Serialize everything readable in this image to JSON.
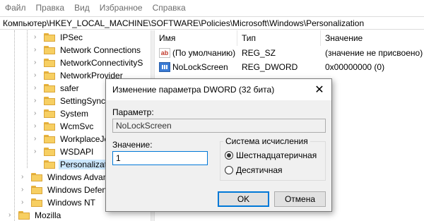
{
  "menu": [
    "Файл",
    "Правка",
    "Вид",
    "Избранное",
    "Справка"
  ],
  "address": "Компьютер\\HKEY_LOCAL_MACHINE\\SOFTWARE\\Policies\\Microsoft\\Windows\\Personalization",
  "tree": [
    {
      "label": "IPSec",
      "expander": true
    },
    {
      "label": "Network Connections",
      "expander": true
    },
    {
      "label": "NetworkConnectivityS",
      "expander": true
    },
    {
      "label": "NetworkProvider",
      "expander": true
    },
    {
      "label": "safer",
      "expander": true
    },
    {
      "label": "SettingSync",
      "expander": true
    },
    {
      "label": "System",
      "expander": true
    },
    {
      "label": "WcmSvc",
      "expander": true
    },
    {
      "label": "WorkplaceJo",
      "expander": true
    },
    {
      "label": "WSDAPI",
      "expander": true
    },
    {
      "label": "Personalization",
      "expander": false,
      "selected": true
    },
    {
      "label": "Windows Advan",
      "expander": true
    },
    {
      "label": "Windows Defen",
      "expander": true
    },
    {
      "label": "Windows NT",
      "expander": true
    },
    {
      "label": "Mozilla",
      "expander": true
    }
  ],
  "list": {
    "headers": [
      "Имя",
      "Тип",
      "Значение"
    ],
    "rows": [
      {
        "icon": "string-value-icon",
        "badge": "ab",
        "name": "(По умолчанию)",
        "type": "REG_SZ",
        "value": "(значение не присвоено)"
      },
      {
        "icon": "binary-value-icon",
        "badge": "",
        "name": "NoLockScreen",
        "type": "REG_DWORD",
        "value": "0x00000000 (0)"
      }
    ]
  },
  "dialog": {
    "title": "Изменение параметра DWORD (32 бита)",
    "close_glyph": "✕",
    "param_label": "Параметр:",
    "param_value": "NoLockScreen",
    "value_label": "Значение:",
    "value": "1",
    "base_label": "Система исчисления",
    "radio_hex": "Шестнадцатеричная",
    "radio_dec": "Десятичная",
    "selected_base": "hex",
    "ok": "OK",
    "cancel": "Отмена"
  }
}
